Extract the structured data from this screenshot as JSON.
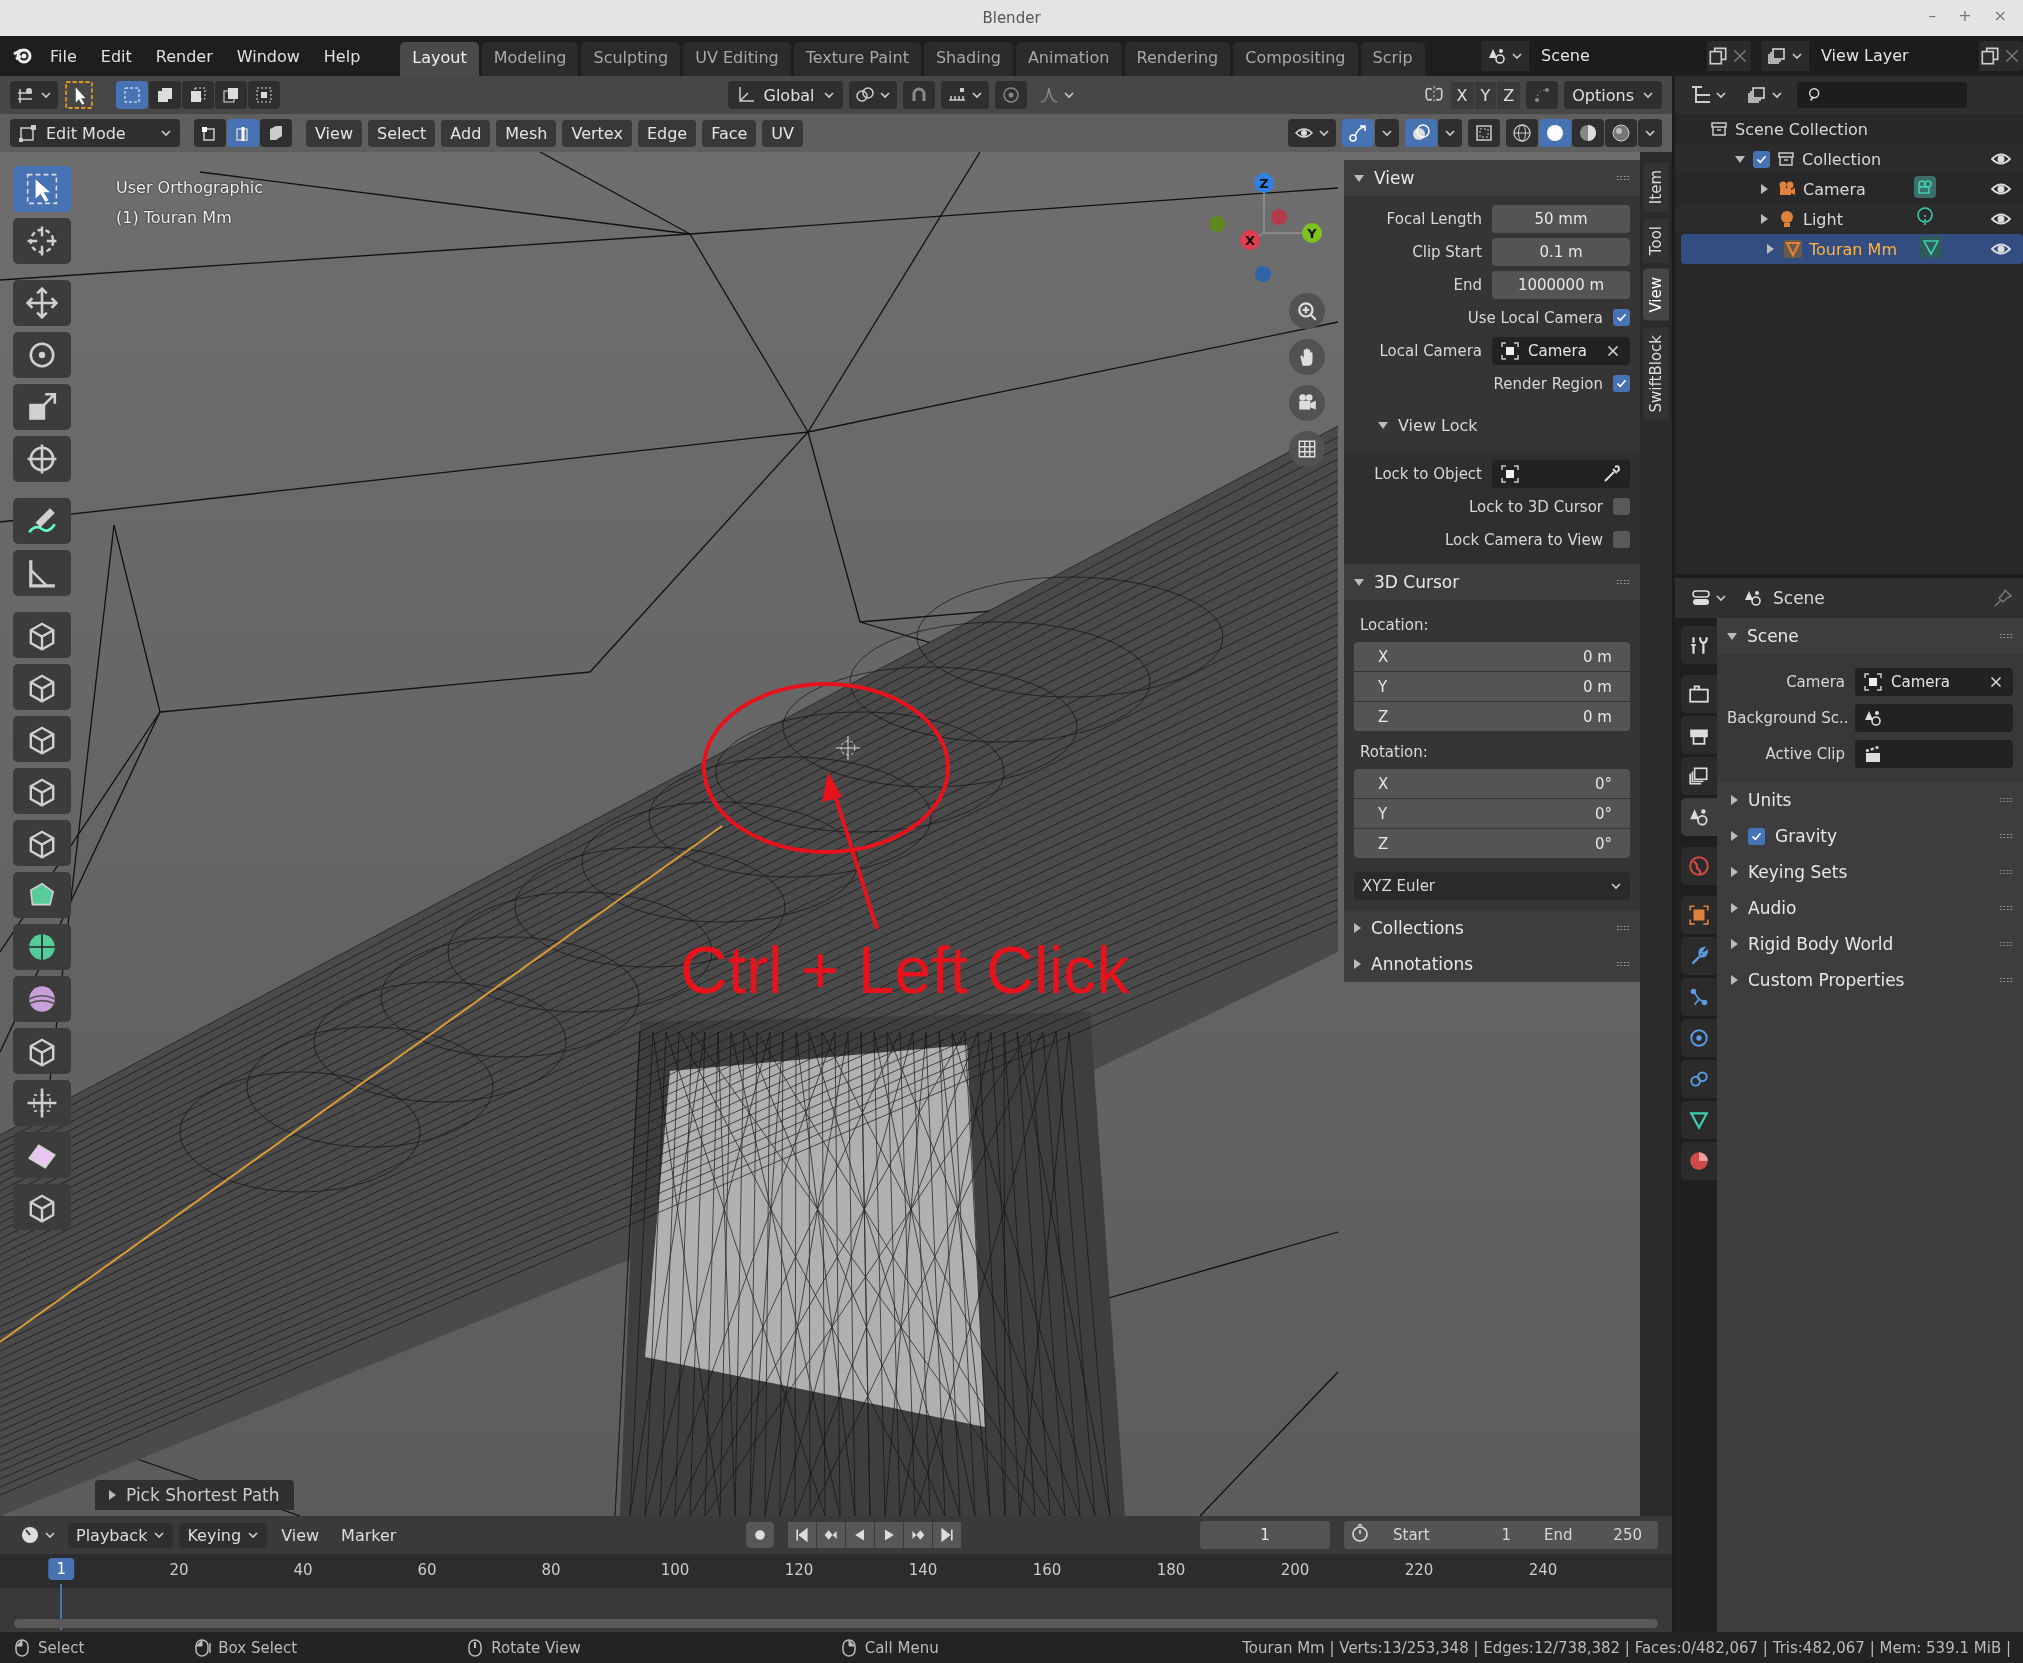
{
  "window": {
    "title": "Blender",
    "controls": [
      "–",
      "+",
      "×"
    ]
  },
  "menu": [
    "File",
    "Edit",
    "Render",
    "Window",
    "Help"
  ],
  "workspaces": [
    {
      "label": "Layout",
      "selected": true
    },
    {
      "label": "Modeling",
      "selected": false
    },
    {
      "label": "Sculpting",
      "selected": false
    },
    {
      "label": "UV Editing",
      "selected": false
    },
    {
      "label": "Texture Paint",
      "selected": false
    },
    {
      "label": "Shading",
      "selected": false
    },
    {
      "label": "Animation",
      "selected": false
    },
    {
      "label": "Rendering",
      "selected": false
    },
    {
      "label": "Compositing",
      "selected": false
    },
    {
      "label": "Scrip",
      "selected": false
    }
  ],
  "scene": "Scene",
  "view_layer": "View Layer",
  "tool_header": {
    "box_modes": [
      {
        "kind": "new",
        "selected": true
      },
      {
        "kind": "extend",
        "selected": false
      },
      {
        "kind": "subtract",
        "selected": false
      },
      {
        "kind": "invert",
        "selected": false
      },
      {
        "kind": "intersect",
        "selected": false
      }
    ],
    "orientation": "Global",
    "axes": [
      "X",
      "Y",
      "Z"
    ],
    "options": "Options"
  },
  "viewport_header": {
    "mode": "Edit Mode",
    "select_modes": [
      {
        "kind": "vertex",
        "selected": false
      },
      {
        "kind": "edge",
        "selected": true
      },
      {
        "kind": "face",
        "selected": false
      }
    ],
    "menus": [
      "View",
      "Select",
      "Add",
      "Mesh",
      "Vertex",
      "Edge",
      "Face",
      "UV"
    ],
    "toggles": [
      {
        "kind": "gizmo",
        "on": true
      },
      {
        "kind": "overlay",
        "on": true
      },
      {
        "kind": "xray",
        "on": false
      }
    ],
    "shading": [
      {
        "kind": "wireframe",
        "selected": false
      },
      {
        "kind": "solid",
        "selected": true
      },
      {
        "kind": "material",
        "selected": false
      },
      {
        "kind": "rendered",
        "selected": false
      }
    ]
  },
  "viewport": {
    "view_name": "User Orthographic",
    "object_name": "(1) Touran Mm",
    "annotation": "Ctrl + Left Click",
    "gizmo_axes": [
      "X",
      "Y",
      "Z"
    ],
    "last_operator": "Pick Shortest Path",
    "tools": [
      {
        "kind": "select",
        "selected": true
      },
      {
        "kind": "cursor",
        "selected": false
      },
      {
        "kind": "move",
        "selected": false
      },
      {
        "kind": "rotate",
        "selected": false
      },
      {
        "kind": "scale",
        "selected": false
      },
      {
        "kind": "transform",
        "selected": false
      },
      {
        "kind": "annotate",
        "selected": false
      },
      {
        "kind": "measure",
        "selected": false
      },
      {
        "kind": "extrude",
        "selected": false
      },
      {
        "kind": "inset",
        "selected": false
      },
      {
        "kind": "bevel",
        "selected": false
      },
      {
        "kind": "loopcut",
        "selected": false
      },
      {
        "kind": "knife",
        "selected": false
      },
      {
        "kind": "polybuild",
        "selected": false
      },
      {
        "kind": "spin",
        "selected": false
      },
      {
        "kind": "smooth",
        "selected": false
      },
      {
        "kind": "slide",
        "selected": false
      },
      {
        "kind": "shrink",
        "selected": false
      },
      {
        "kind": "shear",
        "selected": false
      },
      {
        "kind": "rip",
        "selected": false
      }
    ]
  },
  "sidebar": {
    "tabs": [
      {
        "label": "Item",
        "selected": false
      },
      {
        "label": "Tool",
        "selected": false
      },
      {
        "label": "View",
        "selected": true
      },
      {
        "label": "SwiftBlock",
        "selected": false
      }
    ],
    "view_panel": {
      "title": "View",
      "expanded": true,
      "rows": [
        {
          "kind": "number",
          "label": "Focal Length",
          "value": "50 mm"
        },
        {
          "kind": "number",
          "label": "Clip Start",
          "value": "0.1 m"
        },
        {
          "kind": "number",
          "label": "End",
          "value": "1000000 m"
        },
        {
          "kind": "check",
          "label": "Use Local Camera",
          "checked": true
        },
        {
          "kind": "object",
          "label": "Local Camera",
          "value": "Camera"
        },
        {
          "kind": "check",
          "label": "Render Region",
          "checked": true
        }
      ]
    },
    "view_lock": {
      "title": "View Lock",
      "expanded": true,
      "rows": [
        {
          "kind": "picker",
          "label": "Lock to Object"
        },
        {
          "kind": "check",
          "label": "Lock to 3D Cursor",
          "checked": false
        },
        {
          "kind": "check",
          "label": "Lock Camera to View",
          "checked": false
        }
      ]
    },
    "cursor_panel": {
      "title": "3D Cursor",
      "expanded": true,
      "location_label": "Location:",
      "location": [
        {
          "axis": "X",
          "value": "0 m"
        },
        {
          "axis": "Y",
          "value": "0 m"
        },
        {
          "axis": "Z",
          "value": "0 m"
        }
      ],
      "rotation_label": "Rotation:",
      "rotation": [
        {
          "axis": "X",
          "value": "0°"
        },
        {
          "axis": "Y",
          "value": "0°"
        },
        {
          "axis": "Z",
          "value": "0°"
        }
      ],
      "rotation_mode": "XYZ Euler"
    },
    "closed_panels": [
      {
        "title": "Collections",
        "expanded": false
      },
      {
        "title": "Annotations",
        "expanded": false
      }
    ]
  },
  "outliner": {
    "root": "Scene Collection",
    "tree": [
      {
        "label": "Collection",
        "kind": "collection",
        "checked": true,
        "expanded": true,
        "selected": false,
        "children": [
          {
            "label": "Camera",
            "kind": "camera",
            "expanded": false,
            "selected": false
          },
          {
            "label": "Light",
            "kind": "light",
            "expanded": false,
            "selected": false
          },
          {
            "label": "Touran Mm",
            "kind": "mesh",
            "expanded": false,
            "selected": true
          }
        ]
      }
    ]
  },
  "properties": {
    "header": "Scene",
    "tabs": [
      {
        "kind": "tool",
        "selected": false
      },
      {
        "kind": "render",
        "selected": false
      },
      {
        "kind": "output",
        "selected": false
      },
      {
        "kind": "viewlayer",
        "selected": false
      },
      {
        "kind": "scene",
        "selected": true
      },
      {
        "kind": "world",
        "selected": false
      },
      {
        "kind": "object",
        "selected": false
      },
      {
        "kind": "modifier",
        "selected": false
      },
      {
        "kind": "particles",
        "selected": false
      },
      {
        "kind": "physics",
        "selected": false
      },
      {
        "kind": "constraint",
        "selected": false
      },
      {
        "kind": "data",
        "selected": false
      },
      {
        "kind": "material",
        "selected": false
      }
    ],
    "panel": {
      "title": "Scene",
      "expanded": true,
      "rows": [
        {
          "kind": "camera",
          "label": "Camera",
          "value": "Camera"
        },
        {
          "kind": "scene",
          "label": "Background Sc.."
        },
        {
          "kind": "clip",
          "label": "Active Clip"
        }
      ]
    },
    "subpanels": [
      {
        "kind": "plain",
        "title": "Units",
        "expanded": false
      },
      {
        "kind": "check",
        "title": "Gravity",
        "checked": true,
        "expanded": false
      },
      {
        "kind": "plain",
        "title": "Keying Sets",
        "expanded": false
      },
      {
        "kind": "plain",
        "title": "Audio",
        "expanded": false
      },
      {
        "kind": "plain",
        "title": "Rigid Body World",
        "expanded": false
      },
      {
        "kind": "plain",
        "title": "Custom Properties",
        "expanded": false
      }
    ]
  },
  "timeline": {
    "menus": [
      "Playback",
      "Keying",
      "View",
      "Marker"
    ],
    "current_frame": "1",
    "start_label": "Start",
    "start": "1",
    "end_label": "End",
    "end": "250",
    "playhead": "1",
    "ticks": [
      "20",
      "40",
      "60",
      "80",
      "100",
      "120",
      "140",
      "160",
      "180",
      "200",
      "220",
      "240"
    ]
  },
  "status_bar": {
    "hints": [
      {
        "kind": "left",
        "label": "Select"
      },
      {
        "kind": "drag",
        "label": "Box Select"
      },
      {
        "kind": "middle",
        "label": "Rotate View"
      },
      {
        "kind": "right",
        "label": "Call Menu"
      }
    ],
    "stats": "Touran Mm | Verts:13/253,348 | Edges:12/738,382 | Faces:0/482,067 | Tris:482,067 | Mem: 539.1 MiB |"
  }
}
